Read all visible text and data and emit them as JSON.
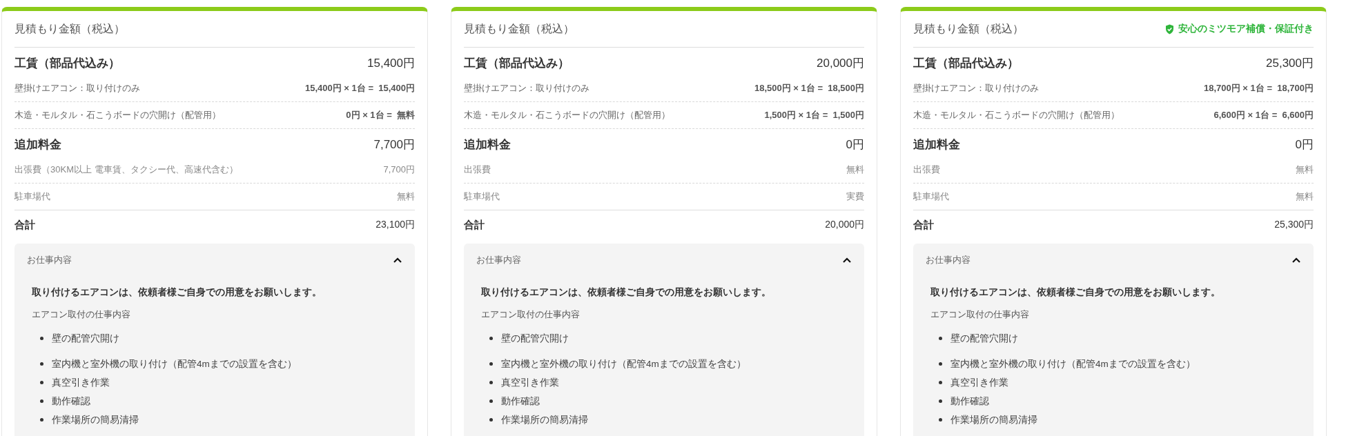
{
  "cards": [
    {
      "title": "見積もり金額（税込）",
      "sections": [
        {
          "title": "工賃（部品代込み）",
          "amount": "15,400円",
          "items": [
            {
              "kind": "unit",
              "label": "壁掛けエアコン：取り付けのみ",
              "price": "15,400円 × 1台 =  15,400円"
            },
            {
              "kind": "unit",
              "label": "木造・モルタル・石こうボードの穴開け（配管用）",
              "price": "0円 × 1台 =  無料"
            }
          ]
        },
        {
          "title": "追加料金",
          "amount": "7,700円",
          "items": [
            {
              "kind": "fee",
              "label": "出張費（30KM以上 電車賃、タクシー代、高速代含む）",
              "price": "7,700円"
            },
            {
              "kind": "fee",
              "label": "駐車場代",
              "price": "無料"
            }
          ]
        }
      ],
      "total": {
        "label": "合計",
        "amount": "23,100円"
      },
      "details": {
        "title": "お仕事内容",
        "expanded": true,
        "note": "取り付けるエアコンは、依頼者様ご自身での用意をお願いします。",
        "subtitle": "エアコン取付の仕事内容",
        "items": [
          "壁の配管穴開け",
          "室内機と室外機の取り付け（配管4mまでの設置を含む）",
          "真空引き作業",
          "動作確認",
          "作業場所の簡易清掃"
        ]
      }
    },
    {
      "title": "見積もり金額（税込）",
      "sections": [
        {
          "title": "工賃（部品代込み）",
          "amount": "20,000円",
          "items": [
            {
              "kind": "unit",
              "label": "壁掛けエアコン：取り付けのみ",
              "price": "18,500円 × 1台 =  18,500円"
            },
            {
              "kind": "unit",
              "label": "木造・モルタル・石こうボードの穴開け（配管用）",
              "price": "1,500円 × 1台 =  1,500円"
            }
          ]
        },
        {
          "title": "追加料金",
          "amount": "0円",
          "items": [
            {
              "kind": "fee",
              "label": "出張費",
              "price": "無料"
            },
            {
              "kind": "fee",
              "label": "駐車場代",
              "price": "実費"
            }
          ]
        }
      ],
      "total": {
        "label": "合計",
        "amount": "20,000円"
      },
      "details": {
        "title": "お仕事内容",
        "expanded": true,
        "note": "取り付けるエアコンは、依頼者様ご自身での用意をお願いします。",
        "subtitle": "エアコン取付の仕事内容",
        "items": [
          "壁の配管穴開け",
          "室内機と室外機の取り付け（配管4mまでの設置を含む）",
          "真空引き作業",
          "動作確認",
          "作業場所の簡易清掃"
        ]
      }
    },
    {
      "title": "見積もり金額（税込）",
      "badge": "安心のミツモア補償・保証付き",
      "sections": [
        {
          "title": "工賃（部品代込み）",
          "amount": "25,300円",
          "items": [
            {
              "kind": "unit",
              "label": "壁掛けエアコン：取り付けのみ",
              "price": "18,700円 × 1台 =  18,700円"
            },
            {
              "kind": "unit",
              "label": "木造・モルタル・石こうボードの穴開け（配管用）",
              "price": "6,600円 × 1台 =  6,600円"
            }
          ]
        },
        {
          "title": "追加料金",
          "amount": "0円",
          "items": [
            {
              "kind": "fee",
              "label": "出張費",
              "price": "無料"
            },
            {
              "kind": "fee",
              "label": "駐車場代",
              "price": "無料"
            }
          ]
        }
      ],
      "total": {
        "label": "合計",
        "amount": "25,300円"
      },
      "details": {
        "title": "お仕事内容",
        "expanded": true,
        "note": "取り付けるエアコンは、依頼者様ご自身での用意をお願いします。",
        "subtitle": "エアコン取付の仕事内容",
        "items": [
          "壁の配管穴開け",
          "室内機と室外機の取り付け（配管4mまでの設置を含む）",
          "真空引き作業",
          "動作確認",
          "作業場所の簡易清掃"
        ]
      }
    }
  ]
}
